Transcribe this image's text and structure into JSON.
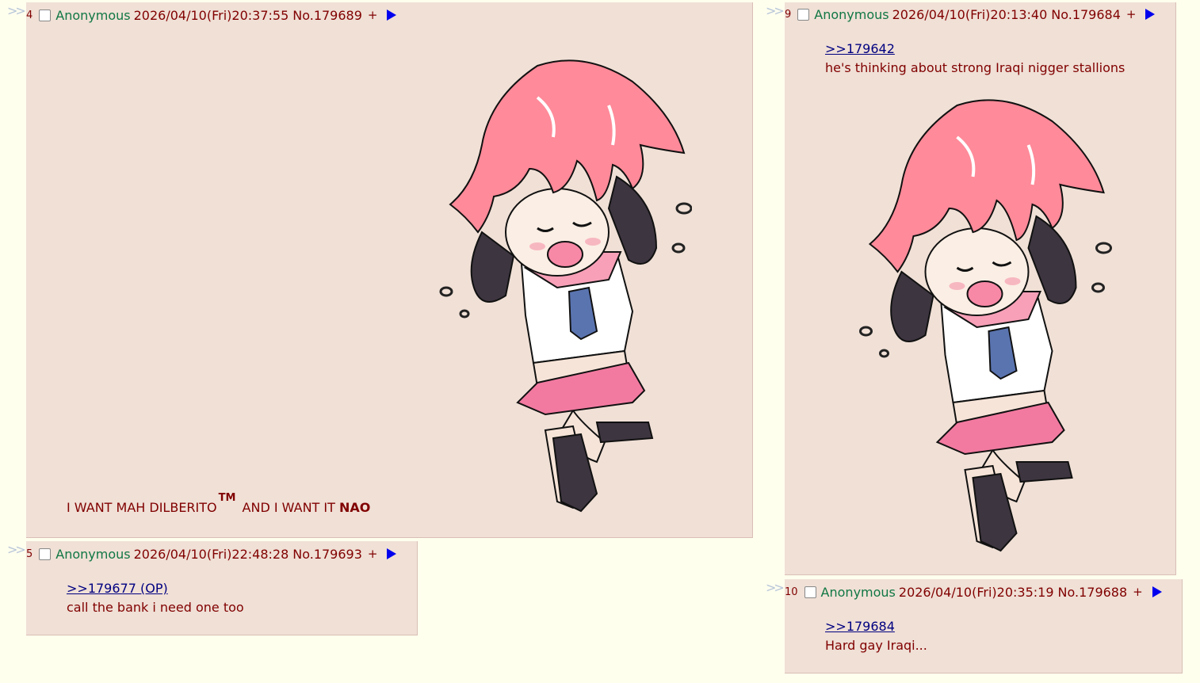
{
  "posts": [
    {
      "index": "4",
      "name": "Anonymous",
      "datetime": "2026/04/10(Fri)20:37:55",
      "number": "No.179689",
      "plus": "+",
      "message": {
        "part1": "I WANT MAH DILBERITO",
        "tm": "TM",
        "part2": "AND I WANT IT",
        "nao": "NAO"
      }
    },
    {
      "index": "5",
      "name": "Anonymous",
      "datetime": "2026/04/10(Fri)22:48:28",
      "number": "No.179693",
      "plus": "+",
      "quote": ">>179677 (OP)",
      "message": "call the bank i need one too"
    },
    {
      "index": "9",
      "name": "Anonymous",
      "datetime": "2026/04/10(Fri)20:13:40",
      "number": "No.179684",
      "plus": "+",
      "quote": ">>179642",
      "message": "he's thinking about strong Iraqi nigger stallions"
    },
    {
      "index": "10",
      "name": "Anonymous",
      "datetime": "2026/04/10(Fri)20:35:19",
      "number": "No.179688",
      "plus": "+",
      "quote": ">>179684",
      "message": "Hard gay Iraqi..."
    }
  ],
  "backlink_arrows": ">>",
  "colors": {
    "background": "#ffffee",
    "post": "#f0e0d6",
    "name": "#117743",
    "text": "#800000",
    "link": "#000080",
    "arrow": "#0000ee"
  },
  "icons": [
    "expand-arrow-icon",
    "checkbox",
    "triangle-right-icon",
    "anime-girl-image"
  ]
}
